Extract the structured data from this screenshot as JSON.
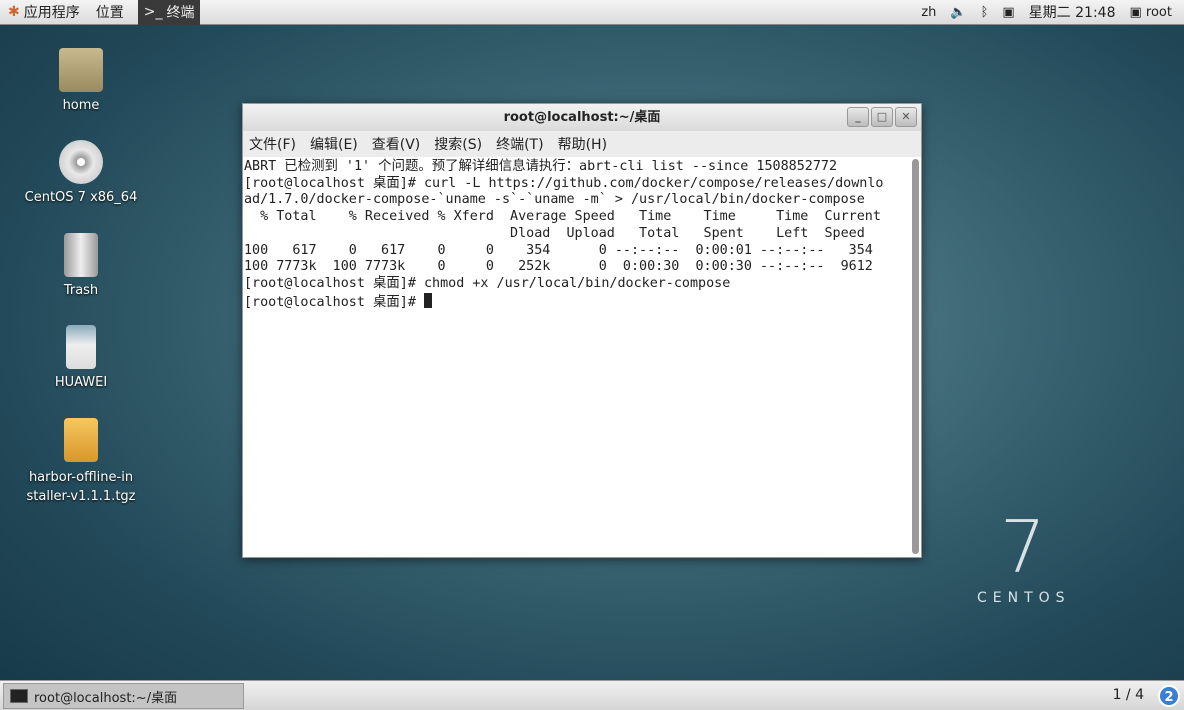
{
  "topbar": {
    "apps": "应用程序",
    "places": "位置",
    "terminal_tab": "终端",
    "lang": "zh",
    "clock": "星期二 21:48",
    "user": "root"
  },
  "desktop": [
    {
      "label": "home",
      "icon": "folder-home-icon"
    },
    {
      "label": "CentOS 7 x86_64",
      "icon": "dvd-icon"
    },
    {
      "label": "Trash",
      "icon": "trash-icon"
    },
    {
      "label": "HUAWEI",
      "icon": "media-player-icon"
    },
    {
      "label": "harbor-offline-installer-v1.1.1.tgz",
      "icon": "archive-icon"
    }
  ],
  "window": {
    "title": "root@localhost:~/桌面",
    "menu": [
      "文件(F)",
      "编辑(E)",
      "查看(V)",
      "搜索(S)",
      "终端(T)",
      "帮助(H)"
    ],
    "lines": [
      "ABRT 已检测到 '1' 个问题。预了解详细信息请执行：abrt-cli list --since 1508852772",
      "[root@localhost 桌面]# curl -L https://github.com/docker/compose/releases/downlo",
      "ad/1.7.0/docker-compose-`uname -s`-`uname -m` > /usr/local/bin/docker-compose",
      "  % Total    % Received % Xferd  Average Speed   Time    Time     Time  Current",
      "                                 Dload  Upload   Total   Spent    Left  Speed",
      "100   617    0   617    0     0    354      0 --:--:--  0:00:01 --:--:--   354",
      "100 7773k  100 7773k    0     0   252k      0  0:00:30  0:00:30 --:--:--  9612",
      "[root@localhost 桌面]# chmod +x /usr/local/bin/docker-compose",
      "[root@localhost 桌面]# "
    ]
  },
  "taskbar": {
    "task": "root@localhost:~/桌面",
    "workspace": "1 / 4",
    "badge": "2"
  },
  "brand": {
    "seven": "7",
    "name": "CENTOS"
  }
}
